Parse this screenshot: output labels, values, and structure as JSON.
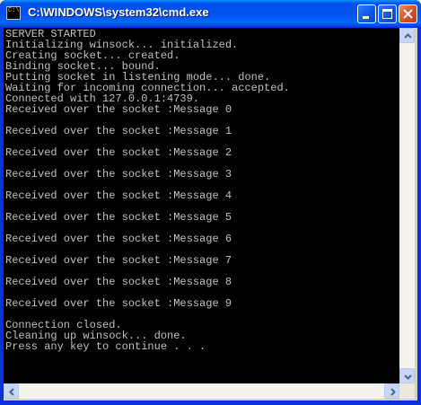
{
  "window": {
    "title": "C:\\WINDOWS\\system32\\cmd.exe",
    "icon_text": "C:\\"
  },
  "console": {
    "lines": [
      "SERVER STARTED",
      "Initializing winsock... initialized.",
      "Creating socket... created.",
      "Binding socket... bound.",
      "Putting socket in listening mode... done.",
      "Waiting for incoming connection... accepted.",
      "Connected with 127.0.0.1:4739.",
      "Received over the socket :Message 0",
      "",
      "Received over the socket :Message 1",
      "",
      "Received over the socket :Message 2",
      "",
      "Received over the socket :Message 3",
      "",
      "Received over the socket :Message 4",
      "",
      "Received over the socket :Message 5",
      "",
      "Received over the socket :Message 6",
      "",
      "Received over the socket :Message 7",
      "",
      "Received over the socket :Message 8",
      "",
      "Received over the socket :Message 9",
      "",
      "Connection closed.",
      "Cleaning up winsock... done.",
      "Press any key to continue . . ."
    ]
  },
  "colors": {
    "console_bg": "#000000",
    "console_fg": "#c0c0c0",
    "titlebar": "#0053ee"
  }
}
